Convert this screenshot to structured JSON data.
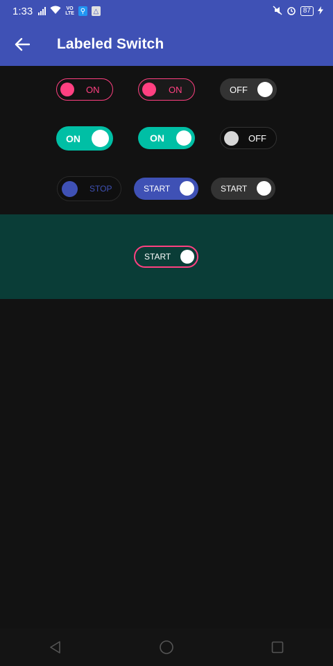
{
  "status_bar": {
    "time": "1:33",
    "network_badge": "VO\nLTE",
    "battery_level": "87",
    "icons": [
      "signal-icon",
      "wifi-icon",
      "volte-icon",
      "usb-icon",
      "drive-icon",
      "mute-icon",
      "alarm-icon",
      "battery-icon",
      "charging-icon"
    ]
  },
  "app_bar": {
    "title": "Labeled Switch",
    "background": "#3f51b5",
    "back_icon": "arrow-left-icon"
  },
  "switches": {
    "row1": [
      {
        "label": "ON",
        "state": "on"
      },
      {
        "label": "ON",
        "state": "on"
      },
      {
        "label": "OFF",
        "state": "off"
      }
    ],
    "row2": [
      {
        "label": "ON",
        "state": "on"
      },
      {
        "label": "ON",
        "state": "on"
      },
      {
        "label": "OFF",
        "state": "off"
      }
    ],
    "row3": [
      {
        "label": "STOP",
        "state": "off"
      },
      {
        "label": "START",
        "state": "on"
      },
      {
        "label": "START",
        "state": "on"
      }
    ],
    "teal_section": {
      "label": "START",
      "state": "on"
    }
  },
  "colors": {
    "pink": "#ff4081",
    "teal_accent": "#00bfa5",
    "indigo": "#3f51b5",
    "dark_track": "#303030",
    "teal_section_bg": "#0a3d37"
  },
  "nav_bar": {
    "icons": [
      "back-triangle-icon",
      "home-circle-icon",
      "recents-square-icon"
    ]
  }
}
